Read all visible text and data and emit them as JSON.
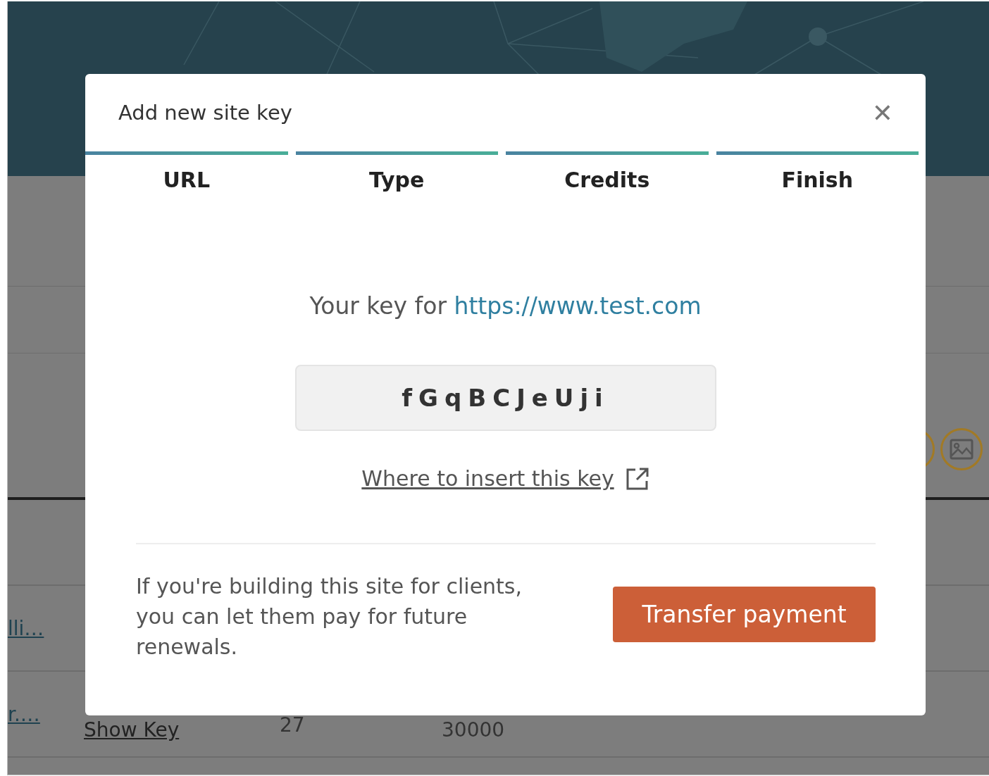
{
  "background": {
    "rows": [
      {
        "column_1": "lli…"
      },
      {
        "column_1": "r.…",
        "action": "Show Key",
        "column_3": "27",
        "column_4": "30000"
      }
    ]
  },
  "dialog": {
    "title": "Add new site key",
    "close": "✕",
    "steps": [
      {
        "label": "URL",
        "done": true
      },
      {
        "label": "Type",
        "done": true
      },
      {
        "label": "Credits",
        "done": true
      },
      {
        "label": "Finish",
        "done": true
      }
    ],
    "message": "Your key for",
    "url": "https://www.test.com",
    "key": "fGqBCJeUji",
    "help_link": "Where to insert this key",
    "footer_text": "If you're building this site for clients, you can let them pay for future renewals.",
    "button": "Transfer payment"
  }
}
